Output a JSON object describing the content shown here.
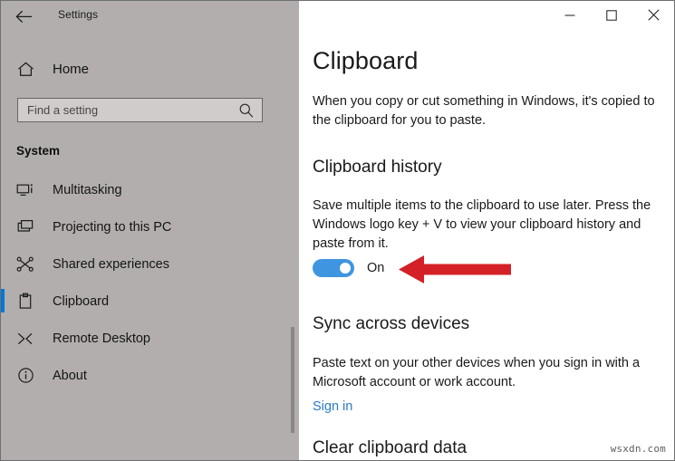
{
  "window": {
    "app_title": "Settings",
    "back_icon": "back-arrow-icon",
    "controls": {
      "minimize_label": "─",
      "maximize_label": "□",
      "close_label": "✕"
    }
  },
  "sidebar": {
    "home": {
      "label": "Home",
      "icon": "home-icon"
    },
    "search": {
      "value": "",
      "placeholder": "Find a setting",
      "icon": "search-icon"
    },
    "group_heading": "System",
    "items": [
      {
        "label": "Multitasking",
        "icon": "multitasking-icon",
        "selected": false
      },
      {
        "label": "Projecting to this PC",
        "icon": "projecting-icon",
        "selected": false
      },
      {
        "label": "Shared experiences",
        "icon": "shared-experiences-icon",
        "selected": false
      },
      {
        "label": "Clipboard",
        "icon": "clipboard-icon",
        "selected": true
      },
      {
        "label": "Remote Desktop",
        "icon": "remote-desktop-icon",
        "selected": false
      },
      {
        "label": "About",
        "icon": "info-icon",
        "selected": false
      }
    ]
  },
  "main": {
    "page_title": "Clipboard",
    "intro_text": "When you copy or cut something in Windows, it's copied to the clipboard for you to paste.",
    "sections": {
      "history": {
        "heading": "Clipboard history",
        "description": "Save multiple items to the clipboard to use later. Press the Windows logo key + V to view your clipboard history and paste from it.",
        "toggle_state": "On"
      },
      "sync": {
        "heading": "Sync across devices",
        "description": "Paste text on your other devices when you sign in with a Microsoft account or work account.",
        "link_label": "Sign in"
      },
      "clear": {
        "heading": "Clear clipboard data"
      }
    }
  },
  "annotation": {
    "arrow_icon": "red-left-arrow-annotation",
    "color": "#d42027"
  },
  "watermark": "wsxdn.com",
  "colors": {
    "accent": "#0078d7",
    "toggle_on": "#3f95e0",
    "link": "#2b7cc4",
    "sidebar_bg": "#b3aeae",
    "main_bg": "#ffffff"
  }
}
